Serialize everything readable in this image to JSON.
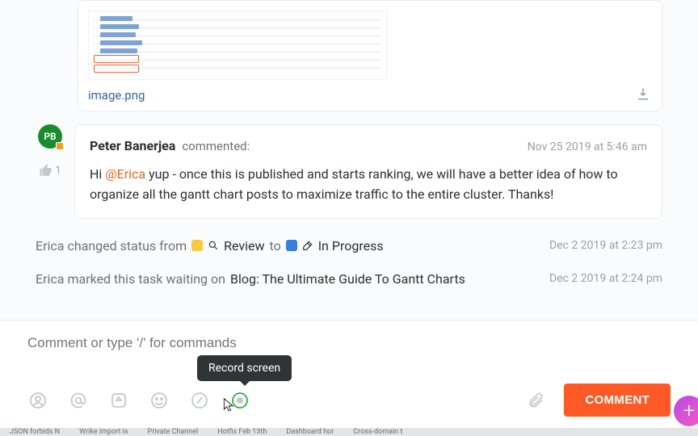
{
  "attachment": {
    "filename": "image.png"
  },
  "comment": {
    "avatar_initials": "PB",
    "author": "Peter Banerjea",
    "action": "commented:",
    "timestamp": "Nov 25 2019 at 5:46 am",
    "like_count": "1",
    "body_pre": "Hi ",
    "mention": "@Erica",
    "body_post": " yup - once this is published and starts ranking, we will have a better idea of how to organize all the gantt chart posts to maximize traffic to the entire cluster. Thanks!"
  },
  "activity1": {
    "pre": "Erica changed status from",
    "from_status": "Review",
    "mid": "to",
    "to_status": "In Progress",
    "ts": "Dec 2 2019 at 2:23 pm"
  },
  "activity2": {
    "pre": "Erica marked this task waiting on",
    "task": "Blog: The Ultimate Guide To Gantt Charts",
    "ts": "Dec 2 2019 at 2:24 pm"
  },
  "composer": {
    "placeholder": "Comment or type '/' for commands",
    "submit": "COMMENT",
    "tooltip": "Record screen"
  },
  "tabs": [
    "JSON forbids N",
    "Wrike Import is",
    "Private Channel",
    "Hotfix Feb 13th",
    "Dashboard hor",
    "Cross-domain t"
  ]
}
